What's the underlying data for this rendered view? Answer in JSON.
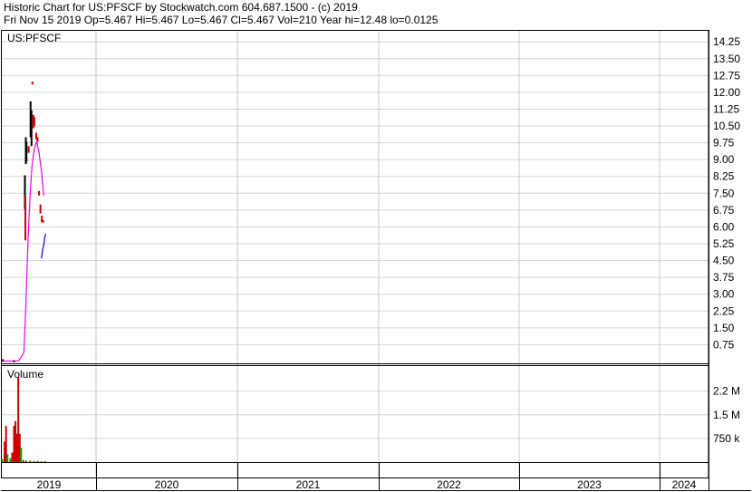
{
  "header": {
    "line1": "Historic Chart for US:PFSCF by Stockwatch.com 604.687.1500 - (c) 2019",
    "line2": "Fri Nov 15 2019  Op=5.467  Hi=5.467  Lo=5.467  Cl=5.467  Vol=210  Year hi=12.48  lo=0.0125"
  },
  "chart_data": [
    {
      "type": "line",
      "title": "US:PFSCF",
      "ylim": [
        0,
        14.5
      ],
      "y_ticks": [
        "0.75",
        "1.50",
        "2.25",
        "3.00",
        "3.75",
        "4.50",
        "5.25",
        "6.00",
        "6.75",
        "7.50",
        "8.25",
        "9.00",
        "9.75",
        "10.50",
        "11.25",
        "12.00",
        "12.75",
        "13.50",
        "14.25"
      ],
      "x_ticks": [
        "2019",
        "2020",
        "2021",
        "2022",
        "2023",
        "2024"
      ],
      "grid": true,
      "colors": {
        "up": "#000000",
        "down": "#cc0000",
        "moving_average": "#ee00ee",
        "recent": "#0000cc"
      },
      "ohlc_bars": [
        {
          "x": 2019.01,
          "high": 0.1,
          "low": 0.0125,
          "color": "#000000"
        },
        {
          "x": 2019.13,
          "high": 0.05,
          "low": 0.02,
          "color": "#000000"
        },
        {
          "x": 2019.245,
          "high": 8.3,
          "low": 6.8,
          "color": "#000000"
        },
        {
          "x": 2019.25,
          "high": 7.4,
          "low": 5.4,
          "color": "#cc0000"
        },
        {
          "x": 2019.255,
          "high": 10.0,
          "low": 8.8,
          "color": "#000000"
        },
        {
          "x": 2019.262,
          "high": 9.8,
          "low": 8.9,
          "color": "#000000"
        },
        {
          "x": 2019.285,
          "high": 9.6,
          "low": 9.3,
          "color": "#cc0000"
        },
        {
          "x": 2019.305,
          "high": 11.6,
          "low": 10.0,
          "color": "#000000"
        },
        {
          "x": 2019.315,
          "high": 11.2,
          "low": 9.6,
          "color": "#000000"
        },
        {
          "x": 2019.325,
          "high": 12.48,
          "low": 12.35,
          "color": "#cc0000"
        },
        {
          "x": 2019.335,
          "high": 11.0,
          "low": 10.4,
          "color": "#cc0000"
        },
        {
          "x": 2019.345,
          "high": 10.9,
          "low": 10.5,
          "color": "#cc0000"
        },
        {
          "x": 2019.365,
          "high": 10.2,
          "low": 9.9,
          "color": "#cc0000"
        },
        {
          "x": 2019.38,
          "high": 10.0,
          "low": 9.8,
          "color": "#cc0000"
        },
        {
          "x": 2019.395,
          "high": 7.6,
          "low": 7.4,
          "color": "#cc0000"
        },
        {
          "x": 2019.41,
          "high": 7.0,
          "low": 6.6,
          "color": "#cc0000"
        },
        {
          "x": 2019.425,
          "high": 6.5,
          "low": 6.2,
          "color": "#cc0000"
        },
        {
          "x": 2019.44,
          "high": 6.3,
          "low": 6.2,
          "color": "#cc0000"
        }
      ],
      "recent_line": {
        "x": [
          2019.42,
          2019.435,
          2019.445,
          2019.455,
          2019.465
        ],
        "y": [
          4.6,
          5.0,
          5.2,
          5.5,
          5.7
        ]
      },
      "moving_average": {
        "x": [
          2019.0,
          2019.18,
          2019.235,
          2019.25,
          2019.265,
          2019.28,
          2019.3,
          2019.32,
          2019.345,
          2019.37,
          2019.395,
          2019.42,
          2019.445
        ],
        "y": [
          0.02,
          0.03,
          0.4,
          1.9,
          3.8,
          5.6,
          7.4,
          8.7,
          9.5,
          9.8,
          9.3,
          8.5,
          7.4
        ]
      }
    },
    {
      "type": "bar",
      "title": "Volume",
      "ylim": [
        0,
        2900000
      ],
      "y_ticks": [
        "750 k",
        "1.5 M",
        "2.2 M"
      ],
      "colors": {
        "up": "#00aa00",
        "down": "#cc0000"
      },
      "bars": [
        {
          "x": 2019.005,
          "value": 100000,
          "color": "#00aa00"
        },
        {
          "x": 2019.03,
          "value": 650000,
          "color": "#cc0000"
        },
        {
          "x": 2019.045,
          "value": 1150000,
          "color": "#cc0000"
        },
        {
          "x": 2019.06,
          "value": 250000,
          "color": "#00aa00"
        },
        {
          "x": 2019.09,
          "value": 120000,
          "color": "#00aa00"
        },
        {
          "x": 2019.11,
          "value": 300000,
          "color": "#cc0000"
        },
        {
          "x": 2019.13,
          "value": 1150000,
          "color": "#cc0000"
        },
        {
          "x": 2019.145,
          "value": 1300000,
          "color": "#cc0000"
        },
        {
          "x": 2019.16,
          "value": 900000,
          "color": "#cc0000"
        },
        {
          "x": 2019.175,
          "value": 2700000,
          "color": "#cc0000"
        },
        {
          "x": 2019.19,
          "value": 900000,
          "color": "#cc0000"
        },
        {
          "x": 2019.205,
          "value": 450000,
          "color": "#00aa00"
        },
        {
          "x": 2019.23,
          "value": 60000,
          "color": "#cc0000"
        },
        {
          "x": 2019.26,
          "value": 50000,
          "color": "#00aa00"
        },
        {
          "x": 2019.3,
          "value": 40000,
          "color": "#cc0000"
        },
        {
          "x": 2019.34,
          "value": 40000,
          "color": "#00aa00"
        },
        {
          "x": 2019.38,
          "value": 35000,
          "color": "#cc0000"
        },
        {
          "x": 2019.42,
          "value": 30000,
          "color": "#00aa00"
        },
        {
          "x": 2019.46,
          "value": 25000,
          "color": "#cc0000"
        }
      ]
    }
  ]
}
